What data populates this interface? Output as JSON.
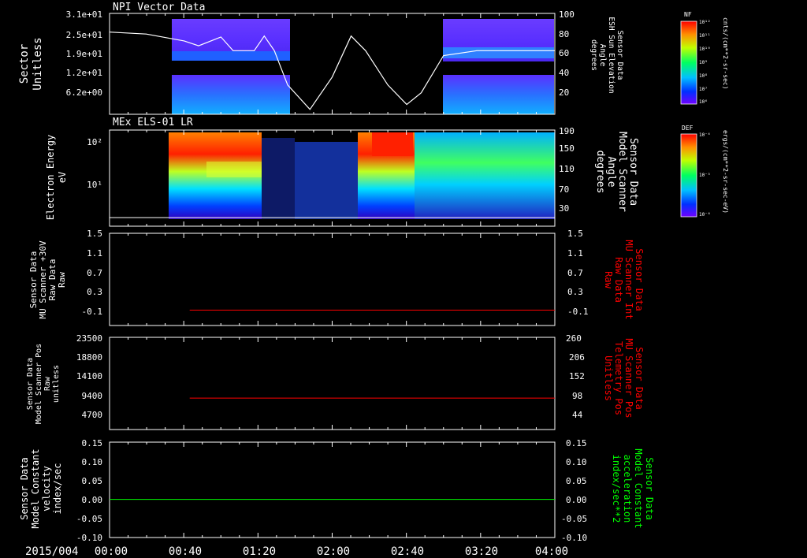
{
  "date_label": "2015/004",
  "time_ticks": [
    "00:00",
    "00:40",
    "01:20",
    "02:00",
    "02:40",
    "03:20",
    "04:00"
  ],
  "colors": {
    "white": "#ffffff",
    "red": "#ff0000",
    "green": "#00ff00",
    "background": "#000000"
  },
  "colorbar_nf": {
    "label": "NF",
    "units": "cnts/(cm**2-sr-sec)",
    "ticks": [
      "10¹²",
      "10¹¹",
      "10¹⁰",
      "10⁹",
      "10⁸",
      "10⁷",
      "10⁶"
    ]
  },
  "colorbar_def": {
    "label": "DEF",
    "units": "ergs/(cm**2-sr-sec-eV)",
    "ticks": [
      "10⁻⁴",
      "10⁻⁵",
      "10⁻⁶"
    ]
  },
  "chart_data": [
    {
      "type": "heatmap",
      "title": "NPI Vector Data",
      "ylabel": [
        "Sector",
        "Unitless"
      ],
      "y_ticks": [
        "3.1e+01",
        "2.5e+01",
        "1.9e+01",
        "1.2e+01",
        "6.2e+00"
      ],
      "right_ylabel": [
        "Sensor Data",
        "ESH Sun Elevation",
        "Angle",
        "degrees"
      ],
      "right_ticks": [
        "100",
        "80",
        "60",
        "40",
        "20"
      ],
      "right_ylim": [
        0,
        100
      ],
      "overlay_line": {
        "x_hours": [
          0,
          0.33,
          0.67,
          0.8,
          1.0,
          1.11,
          1.3,
          1.39,
          1.48,
          1.6,
          1.8,
          2.0,
          2.17,
          2.3,
          2.5,
          2.67,
          2.8,
          3.0,
          3.3,
          3.6,
          4.0
        ],
        "values": [
          84,
          82,
          75,
          70,
          79,
          65,
          65,
          80,
          65,
          30,
          5,
          38,
          80,
          65,
          30,
          10,
          22,
          60,
          65,
          65,
          65
        ]
      }
    },
    {
      "type": "heatmap",
      "title": "MEx ELS-01 LR",
      "ylabel": [
        "Electron Energy",
        "eV"
      ],
      "y_ticks": [
        "10²",
        "10¹"
      ],
      "right_ylabel": [
        "Sensor Data",
        "Model Scanner",
        "Angle",
        "degrees"
      ],
      "right_ticks": [
        "190",
        "150",
        "110",
        "70",
        "30"
      ],
      "right_ylim": [
        0,
        190
      ],
      "overlay_line": {
        "value": 6
      }
    },
    {
      "type": "line",
      "ylabel": [
        "Sensor Data",
        "MU Scanner +30V",
        "Raw Data",
        "Raw"
      ],
      "y_ticks": [
        "1.5",
        "1.1",
        "0.7",
        "0.3",
        "-0.1"
      ],
      "ylim": [
        -0.3,
        1.5
      ],
      "right_ylabel": [
        "Sensor Data",
        "MU Scanner Int",
        "Raw Data",
        "Raw"
      ],
      "right_ticks": [
        "1.5",
        "1.1",
        "0.7",
        "0.3",
        "-0.1"
      ],
      "series": [
        {
          "x_start_hours": 0.72,
          "x_end_hours": 4.0,
          "value": 0.0,
          "color": "#ff0000"
        }
      ]
    },
    {
      "type": "line",
      "ylabel": [
        "Sensor Data",
        "Model Scanner Pos",
        "Raw",
        "unitless"
      ],
      "y_ticks": [
        "23500",
        "18800",
        "14100",
        "9400",
        "4700"
      ],
      "ylim": [
        0,
        23500
      ],
      "right_ylabel": [
        "Sensor Data",
        "MU Scanner Pos",
        "Telemetry Pos",
        "Unitless"
      ],
      "right_ticks": [
        "260",
        "206",
        "152",
        "98",
        "44"
      ],
      "series": [
        {
          "x_start_hours": 0.72,
          "x_end_hours": 4.0,
          "value": 8000,
          "color": "#ff0000"
        }
      ]
    },
    {
      "type": "line",
      "ylabel": [
        "Sensor Data",
        "Model Constant",
        "velocity",
        "index/sec"
      ],
      "y_ticks": [
        "0.15",
        "0.10",
        "0.05",
        "0.00",
        "-0.05",
        "-0.10"
      ],
      "ylim": [
        -0.1,
        0.15
      ],
      "right_ylabel": [
        "Sensor Data",
        "Model Constant",
        "acceleration",
        "index/sec**2"
      ],
      "right_ticks": [
        "0.15",
        "0.10",
        "0.05",
        "0.00",
        "-0.05",
        "-0.10"
      ],
      "series": [
        {
          "x_start_hours": 0.0,
          "x_end_hours": 4.0,
          "value": 0.0,
          "color": "#00ff00"
        }
      ]
    }
  ]
}
